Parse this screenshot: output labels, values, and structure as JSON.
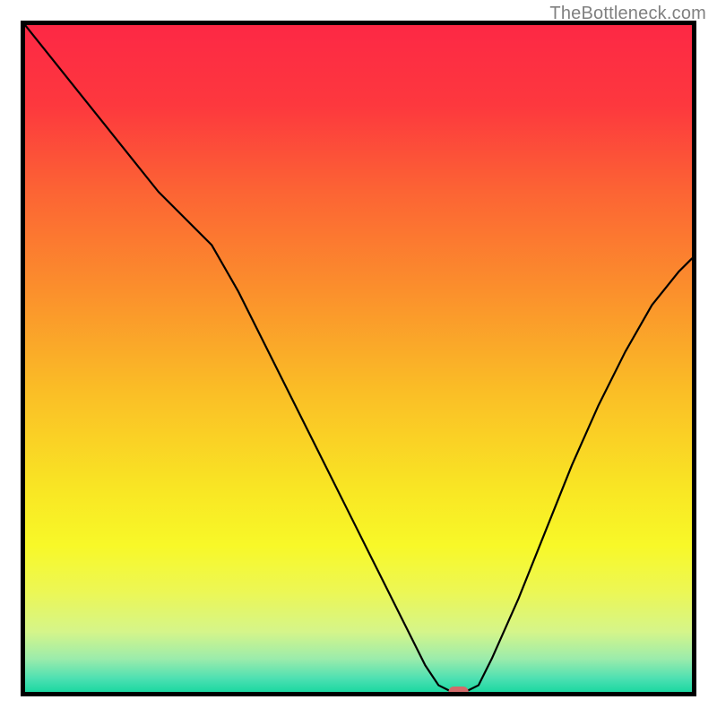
{
  "watermark": "TheBottleneck.com",
  "chart_data": {
    "type": "line",
    "title": "",
    "xlabel": "",
    "ylabel": "",
    "xlim": [
      0,
      100
    ],
    "ylim": [
      0,
      100
    ],
    "grid": false,
    "legend": false,
    "annotations": [],
    "background_gradient": {
      "stops": [
        {
          "offset": 0.0,
          "color": "#fd2845"
        },
        {
          "offset": 0.12,
          "color": "#fd383e"
        },
        {
          "offset": 0.25,
          "color": "#fc6434"
        },
        {
          "offset": 0.4,
          "color": "#fb902c"
        },
        {
          "offset": 0.55,
          "color": "#fabe26"
        },
        {
          "offset": 0.7,
          "color": "#f9e724"
        },
        {
          "offset": 0.78,
          "color": "#f8f828"
        },
        {
          "offset": 0.85,
          "color": "#ecf755"
        },
        {
          "offset": 0.91,
          "color": "#d5f58a"
        },
        {
          "offset": 0.95,
          "color": "#9cecab"
        },
        {
          "offset": 0.98,
          "color": "#4de0b2"
        },
        {
          "offset": 1.0,
          "color": "#1bd8a1"
        }
      ]
    },
    "series": [
      {
        "name": "bottleneck-curve",
        "color": "#000000",
        "x": [
          0,
          4,
          8,
          12,
          16,
          20,
          24,
          28,
          32,
          36,
          40,
          44,
          48,
          52,
          56,
          60,
          62,
          64,
          66,
          68,
          70,
          74,
          78,
          82,
          86,
          90,
          94,
          98,
          100
        ],
        "y": [
          100,
          95,
          90,
          85,
          80,
          75,
          71,
          67,
          60,
          52,
          44,
          36,
          28,
          20,
          12,
          4,
          1,
          0,
          0,
          1,
          5,
          14,
          24,
          34,
          43,
          51,
          58,
          63,
          65
        ]
      }
    ],
    "marker": {
      "name": "minimum-marker",
      "x": 65,
      "y": 0,
      "color": "#d36a6a",
      "width_x": 3.0,
      "height_y": 1.6
    },
    "frame": {
      "color": "#000000",
      "stroke_width": 5
    }
  }
}
